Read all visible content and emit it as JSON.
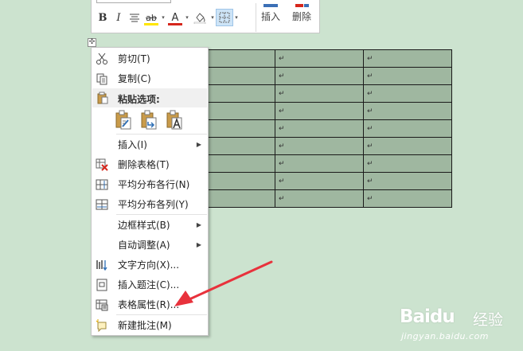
{
  "mini_toolbar": {
    "bold": "B",
    "italic": "I",
    "highlight": "ab",
    "font_color": "A",
    "insert_label": "插入",
    "delete_label": "删除",
    "highlight_color": "#ffe600",
    "font_color_value": "#d6261c"
  },
  "table": {
    "cell_mark": "↵",
    "rows": 9,
    "cols": 4
  },
  "context_menu": {
    "cut": "剪切(T)",
    "copy": "复制(C)",
    "paste_options": "粘贴选项:",
    "insert": "插入(I)",
    "delete_table": "删除表格(T)",
    "distribute_rows": "平均分布各行(N)",
    "distribute_cols": "平均分布各列(Y)",
    "border_styles": "边框样式(B)",
    "autofit": "自动调整(A)",
    "text_direction": "文字方向(X)...",
    "insert_caption": "插入题注(C)...",
    "table_properties": "表格属性(R)...",
    "new_comment": "新建批注(M)"
  },
  "move_handle_icon": "✣",
  "watermark": {
    "logo": "Baidu",
    "cn": "经验",
    "url": "jingyan.baidu.com"
  },
  "colors": {
    "background": "#cce3cf",
    "table_fill": "#9fb7a0",
    "arrow": "#e8323c"
  }
}
